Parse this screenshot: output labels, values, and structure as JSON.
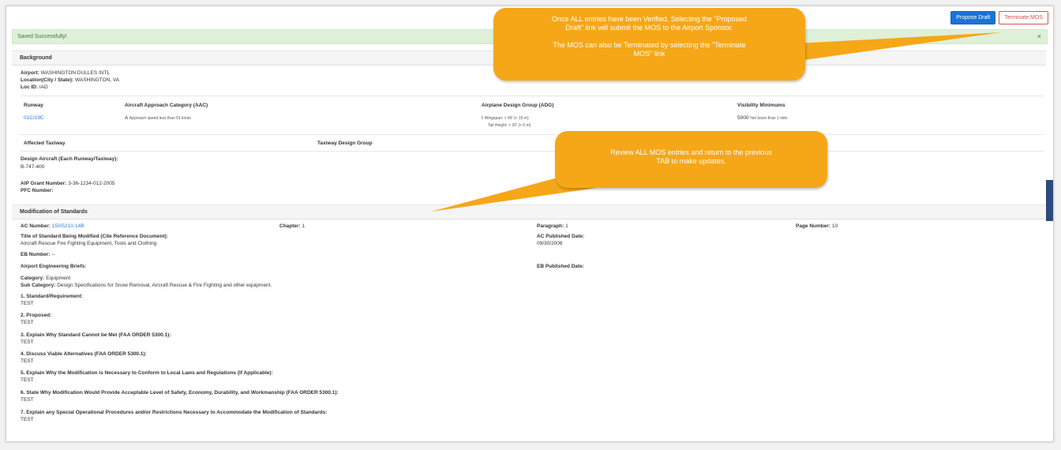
{
  "toolbar": {
    "propose_label": "Propose Draft",
    "terminate_label": "Terminate MOS"
  },
  "alert": {
    "message": "Saved Successfully!",
    "close": "×"
  },
  "background": {
    "title": "Background",
    "airport_label": "Airport:",
    "airport_value": "WASHINGTON DULLES INTL",
    "location_label": "Location(City / State):",
    "location_value": "WASHINGTON, VA",
    "locid_label": "Loc ID:",
    "locid_value": "IAD",
    "headers": {
      "runway": "Runway",
      "aac": "Aircraft Approach Category (AAC)",
      "adg": "Airplane Design Group (ADG)",
      "vis": "Visibility Minimums"
    },
    "runway_value": "01C/19C",
    "aac_letter": "A",
    "aac_desc": "Approach speed less than 91 knots",
    "adg_num": "I",
    "adg_line1": "Wingspan: < 49' (< 15 m)",
    "adg_line2": "Tail Height: < 20' (< 6 m)",
    "vis_num": "5000",
    "vis_desc": "Not lower than 1 mile",
    "affected_taxiway": "Affected Taxiway",
    "taxiway_design_group": "Taxiway Design Group",
    "design_aircraft_label": "Design Aircraft (Each Runway/Taxiway):",
    "design_aircraft_value": "B-747-400",
    "aip_label": "AIP Grant Number:",
    "aip_value": "3-36-1234-012-2005",
    "pfc_label": "PFC Number:"
  },
  "mos": {
    "title": "Modification of Standards",
    "ac_label": "AC Number:",
    "ac_value": "150/5210-14B",
    "chapter_label": "Chapter:",
    "chapter_value": "1",
    "paragraph_label": "Paragraph:",
    "paragraph_value": "1",
    "page_label": "Page Number:",
    "page_value": "10",
    "title_std_label": "Title of Standard Being Modified (Cite Reference Document):",
    "title_std_value": "Aircraft Rescue Fire Fighting Equipment, Tools and Clothing",
    "ac_pub_label": "AC Published Date:",
    "ac_pub_value": "09/30/2008",
    "eb_label": "EB Number:",
    "eb_value": "--",
    "briefs_label": "Airport Engineering Briefs:",
    "eb_pub_label": "EB Published Date:",
    "category_label": "Category:",
    "category_value": "Equipment",
    "subcat_label": "Sub Category:",
    "subcat_value": "Design Specifications for Snow Removal, Aircraft Rescue & Fire Fighting and other equipment.",
    "items": [
      {
        "q": "1. Standard/Requirement:",
        "a": "TEST"
      },
      {
        "q": "2. Proposed:",
        "a": "TEST"
      },
      {
        "q": "3. Explain Why Standard Cannot be Met (FAA ORDER 5300.1):",
        "a": "TEST"
      },
      {
        "q": "4. Discuss Viable Alternatives (FAA ORDER 5300.1):",
        "a": "TEST"
      },
      {
        "q": "5. Explain Why the Modification is Necessary to Conform to Local Laws and Regulations (If Applicable):",
        "a": "TEST"
      },
      {
        "q": "6. State Why Modification Would Provide Acceptable Level of Safety, Economy, Durability, and Workmanship (FAA ORDER 5300.1):",
        "a": "TEST"
      },
      {
        "q": "7. Explain any Special Operational Procedures and/or Restrictions Necessary to Accommodate the Modification of Standards:",
        "a": "TEST"
      }
    ]
  },
  "callouts": {
    "top_line1": "Once ALL entries have been Verified, Selecting the \"Proposed",
    "top_line2": "Draft\" link will submit the MOS to the Airport Sponsor.",
    "top_line3": "The MOS can also be Terminated by selecting the \"Terminate",
    "top_line4": "MOS\" link",
    "mid_line1": "Review ALL MOS entries and return to the previous",
    "mid_line2": "TAB to make updates."
  },
  "colors": {
    "callout": "#f5a718",
    "primary": "#1a73d9",
    "danger": "#d9534f",
    "success_bg": "#dff0d8"
  }
}
